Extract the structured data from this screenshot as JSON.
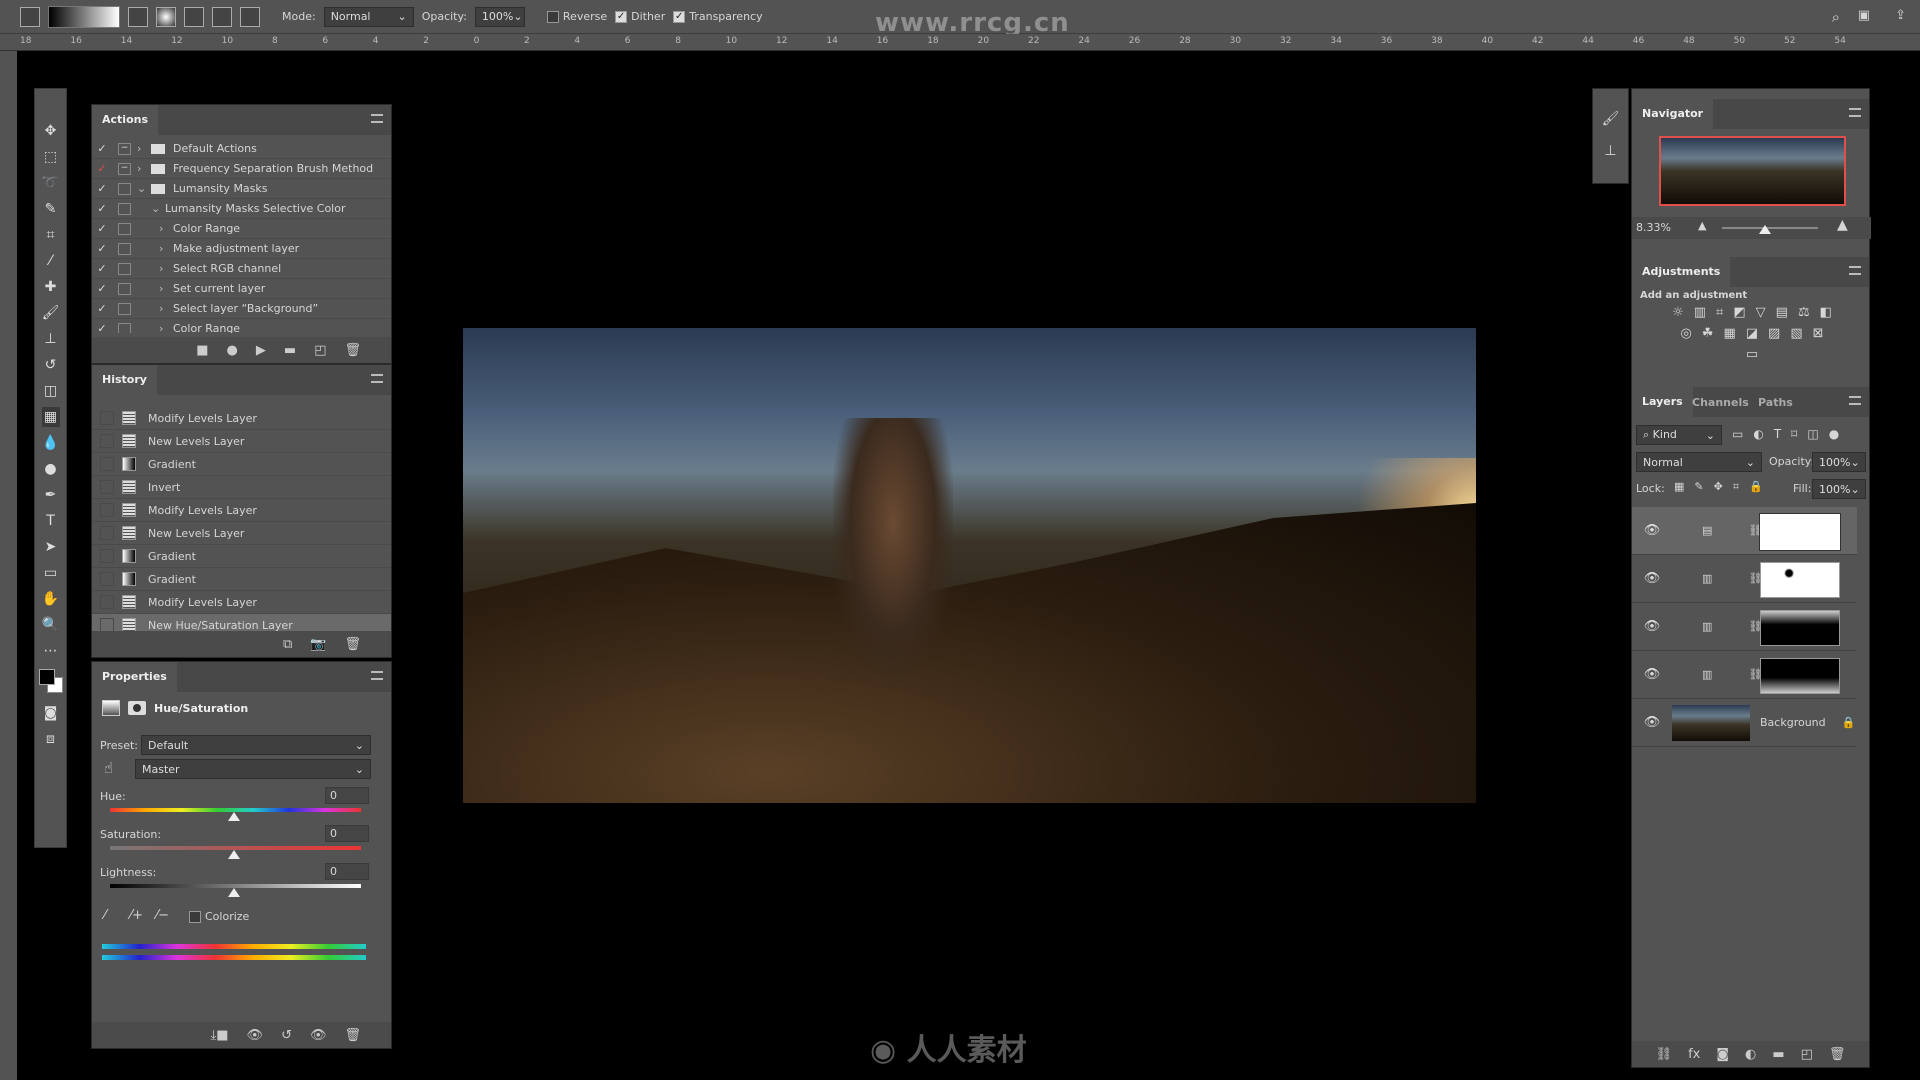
{
  "options_bar": {
    "mode_label": "Mode:",
    "mode_value": "Normal",
    "opacity_label": "Opacity:",
    "opacity_value": "100%",
    "reverse_label": "Reverse",
    "reverse_checked": false,
    "dither_label": "Dither",
    "dither_checked": true,
    "transparency_label": "Transparency",
    "transparency_checked": true
  },
  "watermark": "www.rrcg.cn",
  "ruler_ticks": [
    "18",
    "16",
    "14",
    "12",
    "10",
    "8",
    "6",
    "4",
    "2",
    "0",
    "2",
    "4",
    "6",
    "8",
    "10",
    "12",
    "14",
    "16",
    "18",
    "20",
    "22",
    "24",
    "26",
    "28",
    "30",
    "32",
    "34",
    "36",
    "38",
    "40",
    "42",
    "44",
    "46",
    "48",
    "50",
    "52",
    "54"
  ],
  "actions": {
    "title": "Actions",
    "items": [
      {
        "label": "Default Actions",
        "checked": true,
        "level": 0,
        "folder": true
      },
      {
        "label": "Frequency Separation Brush Method",
        "checked": true,
        "level": 0,
        "folder": true,
        "red": true
      },
      {
        "label": "Lumansity Masks",
        "checked": true,
        "level": 0,
        "folder": true,
        "open": true
      },
      {
        "label": "Lumansity Masks Selective Color",
        "checked": true,
        "level": 1,
        "open": true
      },
      {
        "label": "Color Range",
        "checked": true,
        "level": 2
      },
      {
        "label": "Make adjustment layer",
        "checked": true,
        "level": 2
      },
      {
        "label": "Select RGB channel",
        "checked": true,
        "level": 2
      },
      {
        "label": "Set current layer",
        "checked": true,
        "level": 2
      },
      {
        "label": "Select layer “Background”",
        "checked": true,
        "level": 2
      },
      {
        "label": "Color Range",
        "checked": true,
        "level": 2
      }
    ]
  },
  "history": {
    "title": "History",
    "items": [
      {
        "label": "Modify Levels Layer",
        "icon": "doc"
      },
      {
        "label": "New Levels Layer",
        "icon": "doc"
      },
      {
        "label": "Gradient",
        "icon": "gradient"
      },
      {
        "label": "Invert",
        "icon": "doc"
      },
      {
        "label": "Modify Levels Layer",
        "icon": "doc"
      },
      {
        "label": "New Levels Layer",
        "icon": "doc"
      },
      {
        "label": "Gradient",
        "icon": "gradient"
      },
      {
        "label": "Gradient",
        "icon": "gradient"
      },
      {
        "label": "Modify Levels Layer",
        "icon": "doc"
      },
      {
        "label": "New Hue/Saturation Layer",
        "icon": "doc",
        "selected": true
      }
    ]
  },
  "properties": {
    "title": "Properties",
    "type": "Hue/Saturation",
    "preset_label": "Preset:",
    "preset_value": "Default",
    "channel_value": "Master",
    "hue_label": "Hue:",
    "hue_value": "0",
    "saturation_label": "Saturation:",
    "saturation_value": "0",
    "lightness_label": "Lightness:",
    "lightness_value": "0",
    "colorize_label": "Colorize",
    "colorize_checked": false
  },
  "navigator": {
    "title": "Navigator",
    "zoom": "8.33%",
    "zoom_slider": 0.45
  },
  "adjustments": {
    "title": "Adjustments",
    "subtitle": "Add an adjustment"
  },
  "layers": {
    "tabs": [
      "Layers",
      "Channels",
      "Paths"
    ],
    "filter": "Kind",
    "blend_mode": "Normal",
    "opacity_label": "Opacity:",
    "opacity_value": "100%",
    "lock_label": "Lock:",
    "fill_label": "Fill:",
    "fill_value": "100%",
    "items": [
      {
        "type": "hue-saturation",
        "mask": "white",
        "selected": true
      },
      {
        "type": "levels",
        "mask": "white-dot"
      },
      {
        "type": "levels",
        "mask": "gradient-top"
      },
      {
        "type": "levels",
        "mask": "gradient-bottom"
      },
      {
        "name": "Background",
        "type": "image",
        "locked": true
      }
    ]
  },
  "colors": {
    "panel": "#535353",
    "accent_red": "#e0504a",
    "background": "#000000"
  }
}
